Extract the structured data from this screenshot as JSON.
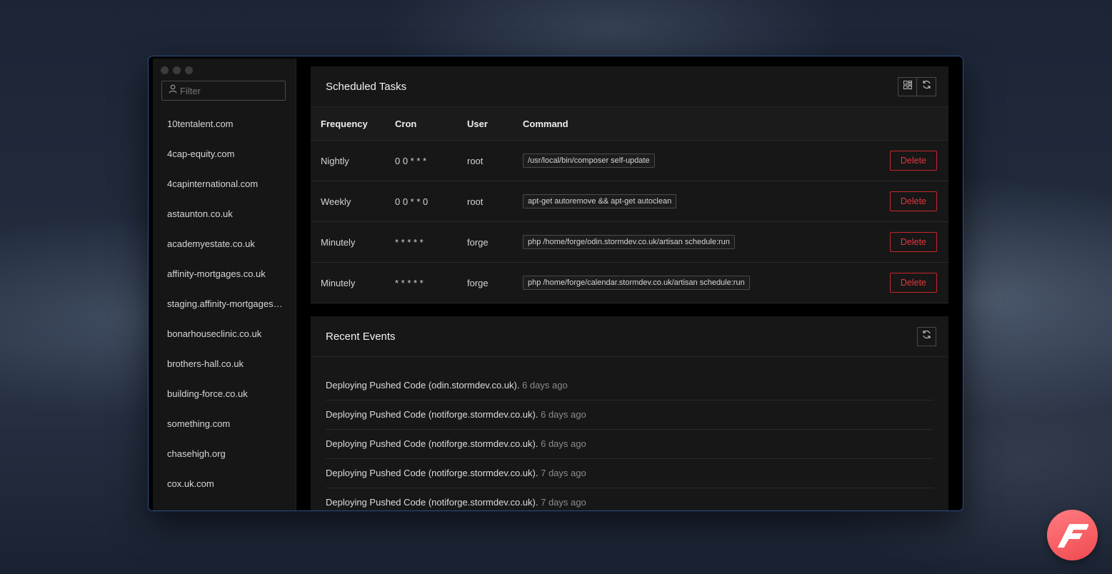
{
  "filter": {
    "placeholder": "Filter"
  },
  "sites": [
    "10tentalent.com",
    "4cap-equity.com",
    "4capinternational.com",
    "astaunton.co.uk",
    "academyestate.co.uk",
    "affinity-mortgages.co.uk",
    "staging.affinity-mortgages.c...",
    "bonarhouseclinic.co.uk",
    "brothers-hall.co.uk",
    "building-force.co.uk",
    "something.com",
    "chasehigh.org",
    "cox.uk.com"
  ],
  "scheduled": {
    "title": "Scheduled Tasks",
    "columns": {
      "frequency": "Frequency",
      "cron": "Cron",
      "user": "User",
      "command": "Command"
    },
    "delete_label": "Delete",
    "rows": [
      {
        "frequency": "Nightly",
        "cron": "0 0 * * *",
        "user": "root",
        "command": "/usr/local/bin/composer self-update"
      },
      {
        "frequency": "Weekly",
        "cron": "0 0 * * 0",
        "user": "root",
        "command": "apt-get autoremove && apt-get autoclean"
      },
      {
        "frequency": "Minutely",
        "cron": "* * * * *",
        "user": "forge",
        "command": "php /home/forge/odin.stormdev.co.uk/artisan schedule:run"
      },
      {
        "frequency": "Minutely",
        "cron": "* * * * *",
        "user": "forge",
        "command": "php /home/forge/calendar.stormdev.co.uk/artisan schedule:run"
      }
    ]
  },
  "events": {
    "title": "Recent Events",
    "items": [
      {
        "text": "Deploying Pushed Code (odin.stormdev.co.uk).",
        "ago": "6 days ago"
      },
      {
        "text": "Deploying Pushed Code (notiforge.stormdev.co.uk).",
        "ago": "6 days ago"
      },
      {
        "text": "Deploying Pushed Code (notiforge.stormdev.co.uk).",
        "ago": "6 days ago"
      },
      {
        "text": "Deploying Pushed Code (notiforge.stormdev.co.uk).",
        "ago": "7 days ago"
      },
      {
        "text": "Deploying Pushed Code (notiforge.stormdev.co.uk).",
        "ago": "7 days ago"
      }
    ]
  },
  "colors": {
    "danger": "#e0383e",
    "window_accent": "#2c4f86",
    "logo": "#f04a52"
  },
  "icons": {
    "filter": "user-icon",
    "view": "grid-layout-icon",
    "refresh": "refresh-icon",
    "logo": "forge-logo-icon"
  }
}
